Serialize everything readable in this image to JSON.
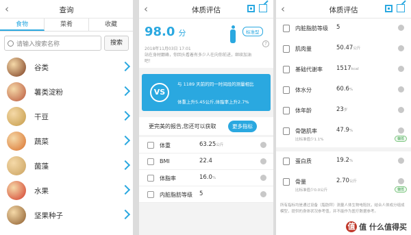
{
  "screen1": {
    "title": "查询",
    "tabs": [
      "食物",
      "菜肴",
      "收藏"
    ],
    "search_placeholder": "请输入搜索名称",
    "search_button": "搜索",
    "items": [
      {
        "name": "谷类",
        "color": "#7a3b1f"
      },
      {
        "name": "薯类淀粉",
        "color": "#b8543a"
      },
      {
        "name": "干豆",
        "color": "#c49a46"
      },
      {
        "name": "蔬菜",
        "color": "#d9702b"
      },
      {
        "name": "菌藻",
        "color": "#c9a15e"
      },
      {
        "name": "水果",
        "color": "#d23a2a"
      },
      {
        "name": "坚果种子",
        "color": "#8a5a2b"
      }
    ]
  },
  "screen2": {
    "title": "体质评估",
    "score": "98.0",
    "score_unit": "分",
    "date": "2018年11月03日 17:01",
    "tip": "站在身材巅峰，你回头看着有多少人在向你前进，继续加油吧！",
    "badge": "标准型",
    "vs_label": "VS",
    "vs_text1": "与 1189 天前的同一时间段的测量相比",
    "vs_text2": "体重上升5.45公斤,体脂率上升2.7%",
    "more_text": "更完美的报告,您还可以获取",
    "more_button": "更多指标",
    "metrics": [
      {
        "label": "体重",
        "value": "63.25",
        "unit": "公斤"
      },
      {
        "label": "BMI",
        "value": "22.4",
        "unit": ""
      },
      {
        "label": "体脂率",
        "value": "16.0",
        "unit": "%"
      },
      {
        "label": "内脏脂肪等级",
        "value": "5",
        "unit": ""
      }
    ]
  },
  "screen3": {
    "title": "体质评估",
    "metrics": [
      {
        "label": "内脏脂肪等级",
        "value": "5",
        "unit": ""
      },
      {
        "label": "肌肉量",
        "value": "50.47",
        "unit": "公斤"
      },
      {
        "label": "基础代谢率",
        "value": "1517",
        "unit": "kcal"
      },
      {
        "label": "体水分",
        "value": "60.6",
        "unit": "%"
      },
      {
        "label": "体年龄",
        "value": "23",
        "unit": "岁"
      },
      {
        "label": "骨骼肌率",
        "value": "47.9",
        "unit": "%",
        "sub": "比标准值少1.1%",
        "tag": "偏低"
      },
      {
        "label": "蛋白质",
        "value": "19.2",
        "unit": "%"
      },
      {
        "label": "骨量",
        "value": "2.70",
        "unit": "公斤",
        "sub": "比标准值少0.0公斤",
        "tag": "偏低"
      }
    ],
    "disclaimer": "所有指标均是通过设备（脂肪秤）测量人体生物电阻抗，结合人体成分组成模型，提供的身体状况参考值，并不能作为医疗数据参考。",
    "watermark": "值 什么值得买",
    "watermark_logo": "值"
  }
}
